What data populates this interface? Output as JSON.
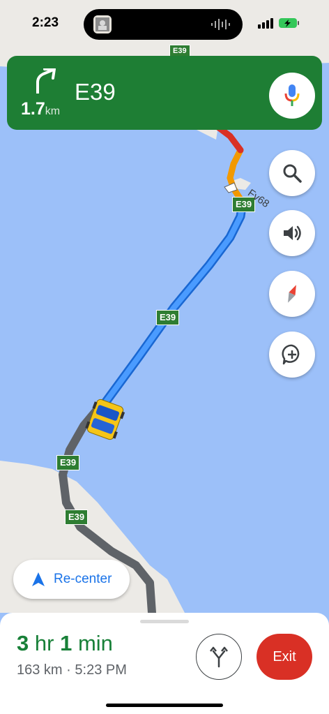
{
  "status_bar": {
    "time": "2:23",
    "signal_icon": "signal-bars-icon",
    "battery_icon": "battery-charging-icon"
  },
  "navigation": {
    "turn_icon": "turn-slight-right-icon",
    "distance_value": "1.7",
    "distance_unit": "km",
    "road": "E39",
    "mic_icon": "microphone-icon"
  },
  "map": {
    "route_shields": [
      "E39",
      "E39",
      "E39",
      "E39",
      "E39"
    ],
    "road_label": "Fv68",
    "colors": {
      "water": "#9cc0f9",
      "land": "#eceae6",
      "route": "#1a73e8",
      "traffic_slow": "#f29900",
      "traffic_jam": "#d93025",
      "traveled": "#5f6368"
    }
  },
  "controls": {
    "search_icon": "search-icon",
    "sound_icon": "volume-icon",
    "compass_icon": "compass-icon",
    "report_icon": "add-report-icon"
  },
  "recenter": {
    "label": "Re-center"
  },
  "trip": {
    "hours": "3",
    "hours_unit": "hr",
    "minutes": "1",
    "minutes_unit": "min",
    "distance": "163 km",
    "separator": "·",
    "arrival": "5:23 PM",
    "alternate_icon": "alternate-routes-icon",
    "exit_label": "Exit"
  }
}
